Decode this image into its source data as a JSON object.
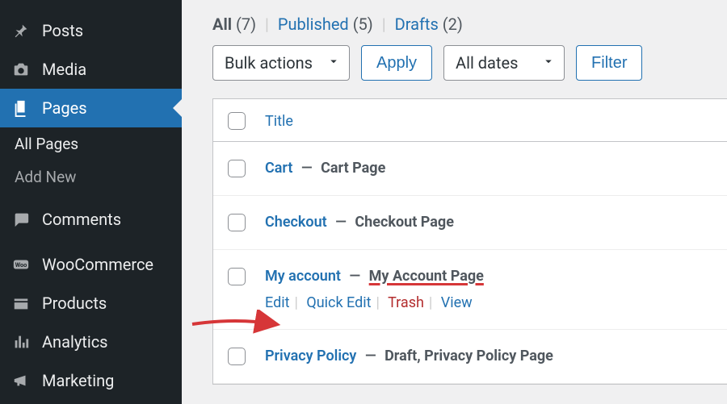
{
  "sidebar": {
    "items": [
      {
        "name": "posts",
        "icon": "pin-icon",
        "label": "Posts"
      },
      {
        "name": "media",
        "icon": "camera-icon",
        "label": "Media"
      },
      {
        "name": "pages",
        "icon": "pages-icon",
        "label": "Pages",
        "active": true
      },
      {
        "name": "all-pages",
        "sub": true,
        "label": "All Pages"
      },
      {
        "name": "add-new",
        "sub": true,
        "dim": true,
        "label": "Add New"
      },
      {
        "name": "comments",
        "icon": "comment-icon",
        "label": "Comments"
      },
      {
        "name": "woocommerce",
        "icon": "woo-icon",
        "label": "WooCommerce"
      },
      {
        "name": "products",
        "icon": "products-icon",
        "label": "Products"
      },
      {
        "name": "analytics",
        "icon": "analytics-icon",
        "label": "Analytics"
      },
      {
        "name": "marketing",
        "icon": "megaphone-icon",
        "label": "Marketing"
      }
    ]
  },
  "subsubsub": {
    "all_label": "All",
    "all_count": "(7)",
    "published_label": "Published",
    "published_count": "(5)",
    "drafts_label": "Drafts",
    "drafts_count": "(2)"
  },
  "tablenav": {
    "bulk_actions": "Bulk actions",
    "apply": "Apply",
    "all_dates": "All dates",
    "filter": "Filter"
  },
  "table": {
    "title_header": "Title",
    "rows": [
      {
        "title": "Cart",
        "meta": "Cart Page"
      },
      {
        "title": "Checkout",
        "meta": "Checkout Page"
      },
      {
        "title": "My account",
        "meta": "My Account Page",
        "highlight": true,
        "show_actions": true
      },
      {
        "title": "Privacy Policy",
        "meta": "Draft, Privacy Policy Page"
      }
    ],
    "actions": {
      "edit": "Edit",
      "quick_edit": "Quick Edit",
      "trash": "Trash",
      "view": "View"
    }
  }
}
